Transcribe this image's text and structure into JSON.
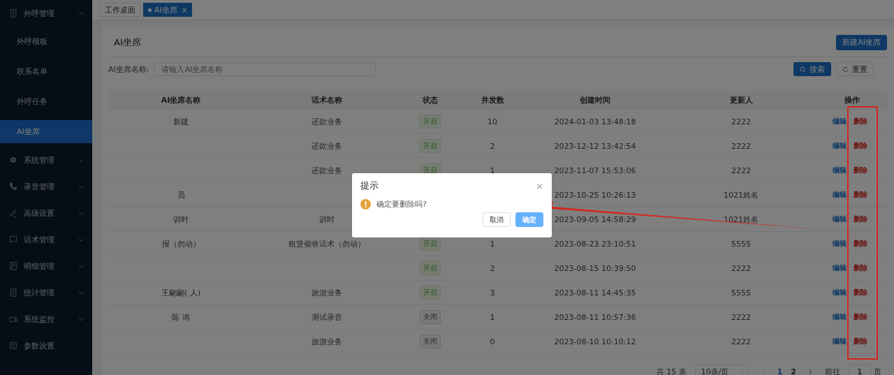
{
  "sidebar": {
    "items": [
      {
        "label": "外呼管理",
        "expanded": true,
        "children": [
          {
            "label": "外呼模板",
            "selected": false
          },
          {
            "label": "联系名单",
            "selected": false
          },
          {
            "label": "外呼任务",
            "selected": false
          },
          {
            "label": "AI坐席",
            "selected": true
          }
        ]
      },
      {
        "label": "系统管理",
        "expanded": false
      },
      {
        "label": "录音管理",
        "expanded": false
      },
      {
        "label": "高级设置",
        "expanded": false
      },
      {
        "label": "话术管理",
        "expanded": false
      },
      {
        "label": "明细管理",
        "expanded": false
      },
      {
        "label": "统计管理",
        "expanded": false
      },
      {
        "label": "系统监控",
        "expanded": false
      },
      {
        "label": "参数设置"
      }
    ]
  },
  "tabs": [
    {
      "label": "工作桌面",
      "selected": false,
      "closable": false
    },
    {
      "label": "AI坐席",
      "selected": true,
      "closable": true,
      "close": "×"
    }
  ],
  "page": {
    "title": "AI坐席",
    "new_button": "新建AI坐席"
  },
  "filter": {
    "label": "AI坐席名称:",
    "placeholder": "请输入AI坐席名称",
    "search": "搜索",
    "reset": "重置"
  },
  "table": {
    "columns": [
      "AI坐席名称",
      "话术名称",
      "状态",
      "并发数",
      "创建时间",
      "更新人",
      "操作"
    ],
    "rows": [
      {
        "name": "新建",
        "script": "还款业务",
        "status": {
          "label": "开启",
          "on": true
        },
        "count": "10",
        "created": "2024-01-03 13:48:18",
        "updater": "2222",
        "actions": [
          "编辑",
          "删除"
        ]
      },
      {
        "script": "还款业务",
        "status": {
          "label": "开启",
          "on": true
        },
        "count": "2",
        "created": "2023-12-12 13:42:54",
        "updater": "2222",
        "actions": [
          "编辑",
          "删除"
        ]
      },
      {
        "script": "还款业务",
        "status": {
          "label": "开启",
          "on": true
        },
        "count": "1",
        "created": "2023-11-07 15:53:06",
        "updater": "2222",
        "actions": [
          "编辑",
          "删除"
        ]
      },
      {
        "name": "员",
        "created": "2023-10-25 10:26:13",
        "updater": "1021姓名",
        "actions": [
          "编辑",
          "删除"
        ]
      },
      {
        "name": "训时",
        "script": "训时",
        "created": "2023-09-05 14:58:29",
        "updater": "1021姓名",
        "actions": [
          "编辑",
          "删除"
        ]
      },
      {
        "name": "报（勿动）",
        "script": "租赁催收话术（勿动）",
        "status": {
          "label": "开启",
          "on": true
        },
        "count": "1",
        "created": "2023-08-23 23:10:51",
        "updater": "5555",
        "actions": [
          "编辑",
          "删除"
        ]
      },
      {
        "status": {
          "label": "开启",
          "on": true
        },
        "count": "2",
        "created": "2023-08-15 10:39:50",
        "updater": "2222",
        "actions": [
          "编辑",
          "删除"
        ]
      },
      {
        "name": "王翩翩(  人)",
        "script": "旅游业务",
        "status": {
          "label": "开启",
          "on": true
        },
        "count": "3",
        "created": "2023-08-11 14:45:35",
        "updater": "5555",
        "actions": [
          "编辑",
          "删除"
        ]
      },
      {
        "name": "陈  询",
        "script": "测试录音",
        "status": {
          "label": "关闭",
          "on": false
        },
        "count": "1",
        "created": "2023-08-11 10:57:36",
        "updater": "2222",
        "actions": [
          "编辑",
          "删除"
        ]
      },
      {
        "script": "旅游业务",
        "status": {
          "label": "关闭",
          "on": false
        },
        "count": "0",
        "created": "2023-08-10 10:10:12",
        "updater": "2222",
        "actions": [
          "编辑",
          "删除"
        ]
      }
    ]
  },
  "pagination": {
    "total": "共 15 条",
    "page_size": "10条/页",
    "pages": [
      {
        "label": "1",
        "selected": true
      },
      {
        "label": "2",
        "selected": false
      }
    ],
    "goto": "前往",
    "goto_value": "1",
    "page_unit": "页"
  },
  "dialog": {
    "title": "提示",
    "close": "×",
    "message": "确定要删除吗?",
    "cancel": "取消",
    "confirm": "确定"
  }
}
